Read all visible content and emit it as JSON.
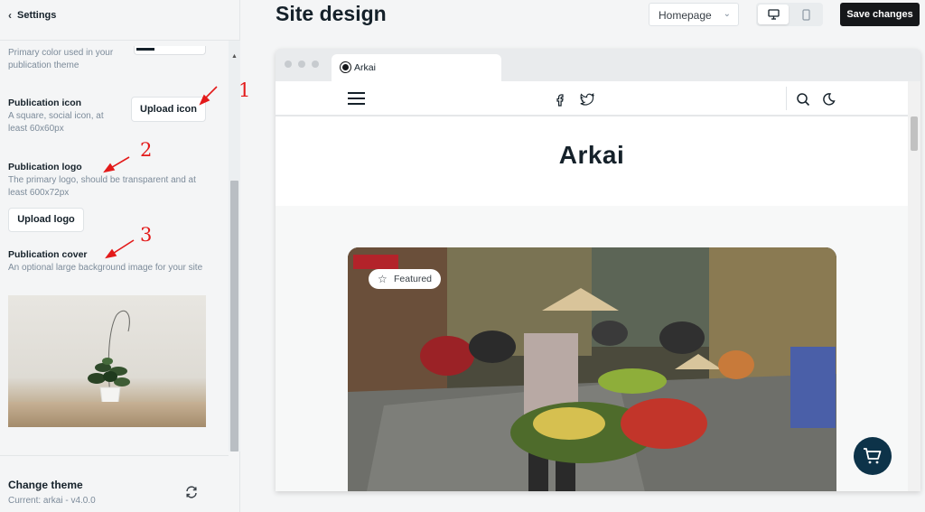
{
  "sidebar": {
    "back_label": "Settings",
    "primary_color_desc": "Primary color used in your publication theme",
    "icon": {
      "label": "Publication icon",
      "desc": "A square, social icon, at least 60x60px",
      "button": "Upload icon"
    },
    "logo": {
      "label": "Publication logo",
      "desc": "The primary logo, should be transparent and at least 600x72px",
      "button": "Upload logo"
    },
    "cover": {
      "label": "Publication cover",
      "desc": "An optional large background image for your site"
    },
    "theme": {
      "title": "Change theme",
      "current": "Current: arkai - v4.0.0"
    }
  },
  "annotations": [
    "1",
    "2",
    "3"
  ],
  "header": {
    "title": "Site design",
    "page_select": "Homepage",
    "save_label": "Save changes"
  },
  "preview": {
    "tab_title": "Arkai",
    "site_title": "Arkai",
    "featured_label": "Featured"
  },
  "colors": {
    "accent_dark": "#15171a",
    "cart_button": "#0d3349",
    "annotation_red": "#e31a1a"
  }
}
